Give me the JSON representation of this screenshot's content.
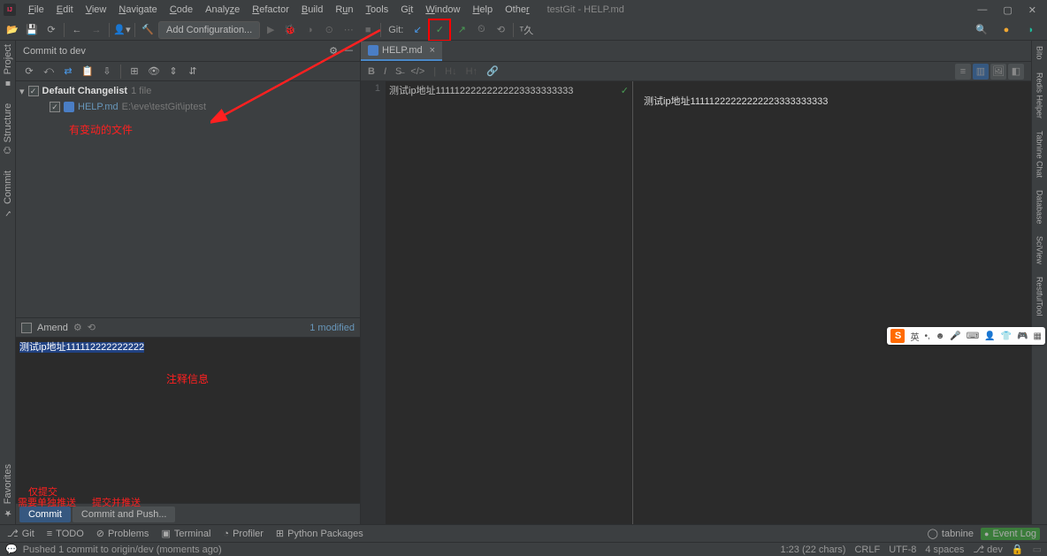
{
  "title": "testGit - HELP.md",
  "menu": [
    "File",
    "Edit",
    "View",
    "Navigate",
    "Code",
    "Analyze",
    "Refactor",
    "Build",
    "Run",
    "Tools",
    "Git",
    "Window",
    "Help",
    "Other"
  ],
  "toolbar": {
    "add_config": "Add Configuration...",
    "git_label": "Git:"
  },
  "commit_panel": {
    "title": "Commit to dev",
    "changelist": "Default Changelist",
    "changelist_count": "1 file",
    "file_name": "HELP.md",
    "file_path": "E:\\eve\\testGit\\iptest",
    "annotation_files": "有变动的文件",
    "amend": "Amend",
    "modified": "1 modified",
    "commit_msg": "测试ip地址111112222222222",
    "annotation_msg": "注释信息",
    "annotation_only_commit": "仅提交",
    "annotation_push_sep": "需要单独推送",
    "annotation_commit_push": "提交并推送",
    "btn_commit": "Commit",
    "btn_commit_push": "Commit and Push..."
  },
  "editor": {
    "tab": "HELP.md",
    "line_no": "1",
    "content": "测试ip地址11111222222222223333333333",
    "preview": "测试ip地址11111222222222223333333333"
  },
  "right_tools": [
    "Bito",
    "Redis Helper",
    "Tabnine Chat",
    "Database",
    "SciView",
    "RestfulTool"
  ],
  "left_tools": [
    "Project",
    "Structure",
    "Commit",
    "Favorites"
  ],
  "bottom_tools": {
    "git": "Git",
    "todo": "TODO",
    "problems": "Problems",
    "terminal": "Terminal",
    "profiler": "Profiler",
    "python": "Python Packages",
    "tabnine": "tabnine",
    "event_log": "Event Log"
  },
  "status": {
    "msg": "Pushed 1 commit to origin/dev (moments ago)",
    "pos": "1:23 (22 chars)",
    "eol": "CRLF",
    "enc": "UTF-8",
    "indent": "4 spaces",
    "branch": "dev"
  },
  "ime": {
    "s": "S",
    "lang": "英"
  }
}
